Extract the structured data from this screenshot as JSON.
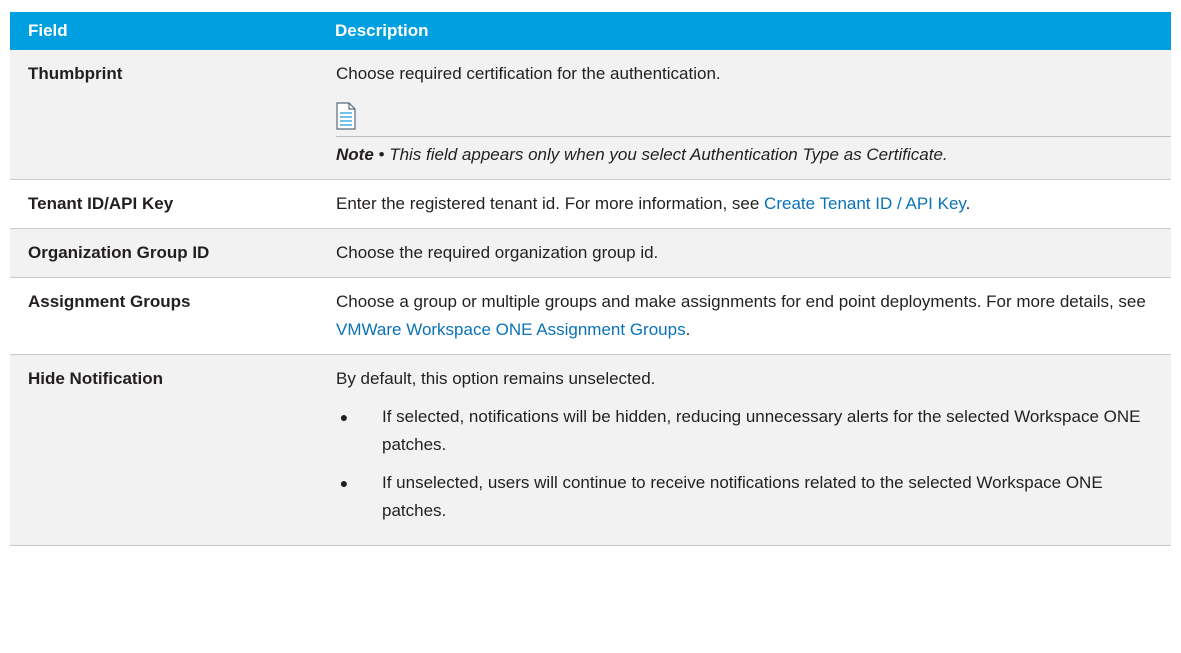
{
  "table": {
    "headers": [
      "Field",
      "Description"
    ],
    "rows": [
      {
        "field": "Thumbprint",
        "description": "Choose required certification for the authentication.",
        "note_label": "Note",
        "note_separator": " • ",
        "note_text": "This field appears only when you select Authentication Type as Certificate."
      },
      {
        "field": "Tenant ID/API Key",
        "description": "Enter the registered tenant id. For more information, see ",
        "link": "Create Tenant ID / API Key",
        "suffix": "."
      },
      {
        "field": "Organization Group ID",
        "description": "Choose the required organization group id."
      },
      {
        "field": "Assignment Groups",
        "description": "Choose a group or multiple groups and make assignments for end point deployments. For more details, see ",
        "link": "VMWare Workspace ONE Assignment Groups",
        "suffix": "."
      },
      {
        "field": "Hide Notification",
        "description": "By default, this option remains unselected.",
        "bullets": [
          "If selected, notifications will be hidden, reducing unnecessary alerts for the selected Workspace ONE patches.",
          "If unselected, users will continue to receive notifications related to the selected Workspace ONE patches."
        ]
      }
    ]
  },
  "colors": {
    "header_bg": "#009fdf",
    "link": "#0a72b8",
    "alt_row_bg": "#f2f2f2"
  },
  "icons": {
    "note": "note-document-icon",
    "bullet": "bullet-dot"
  }
}
